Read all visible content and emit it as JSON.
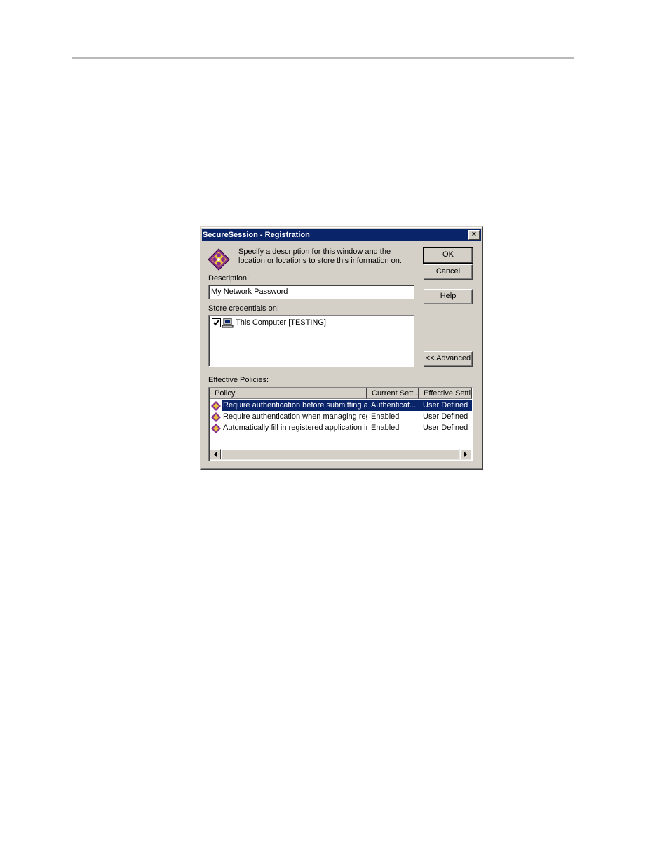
{
  "dialog": {
    "title": "SecureSession - Registration",
    "close_glyph": "×",
    "intro_text": "Specify a description for this window and the location or locations to store this information on.",
    "description_label": "Description:",
    "description_value": "My Network Password",
    "store_label": "Store credentials on:",
    "store_items": [
      {
        "label": "This Computer [TESTING]",
        "checked": true,
        "icon": "computer-icon"
      }
    ],
    "buttons": {
      "ok": "OK",
      "cancel": "Cancel",
      "help": "Help",
      "advanced": "<< Advanced"
    },
    "policies_label": "Effective Policies:",
    "policies": {
      "columns": [
        "Policy",
        "Current Setti...",
        "Effective Setti..."
      ],
      "rows": [
        {
          "policy": "Require authentication before submitting ac...",
          "current": "Authenticat...",
          "effective": "User Defined",
          "selected": true
        },
        {
          "policy": "Require authentication when managing regis...",
          "current": "Enabled",
          "effective": "User Defined",
          "selected": false
        },
        {
          "policy": "Automatically fill in registered application info...",
          "current": "Enabled",
          "effective": "User Defined",
          "selected": false
        }
      ]
    },
    "colors": {
      "title_bar": "#0a246a",
      "dialog_face": "#d4d0c8",
      "selection": "#0a246a"
    }
  }
}
